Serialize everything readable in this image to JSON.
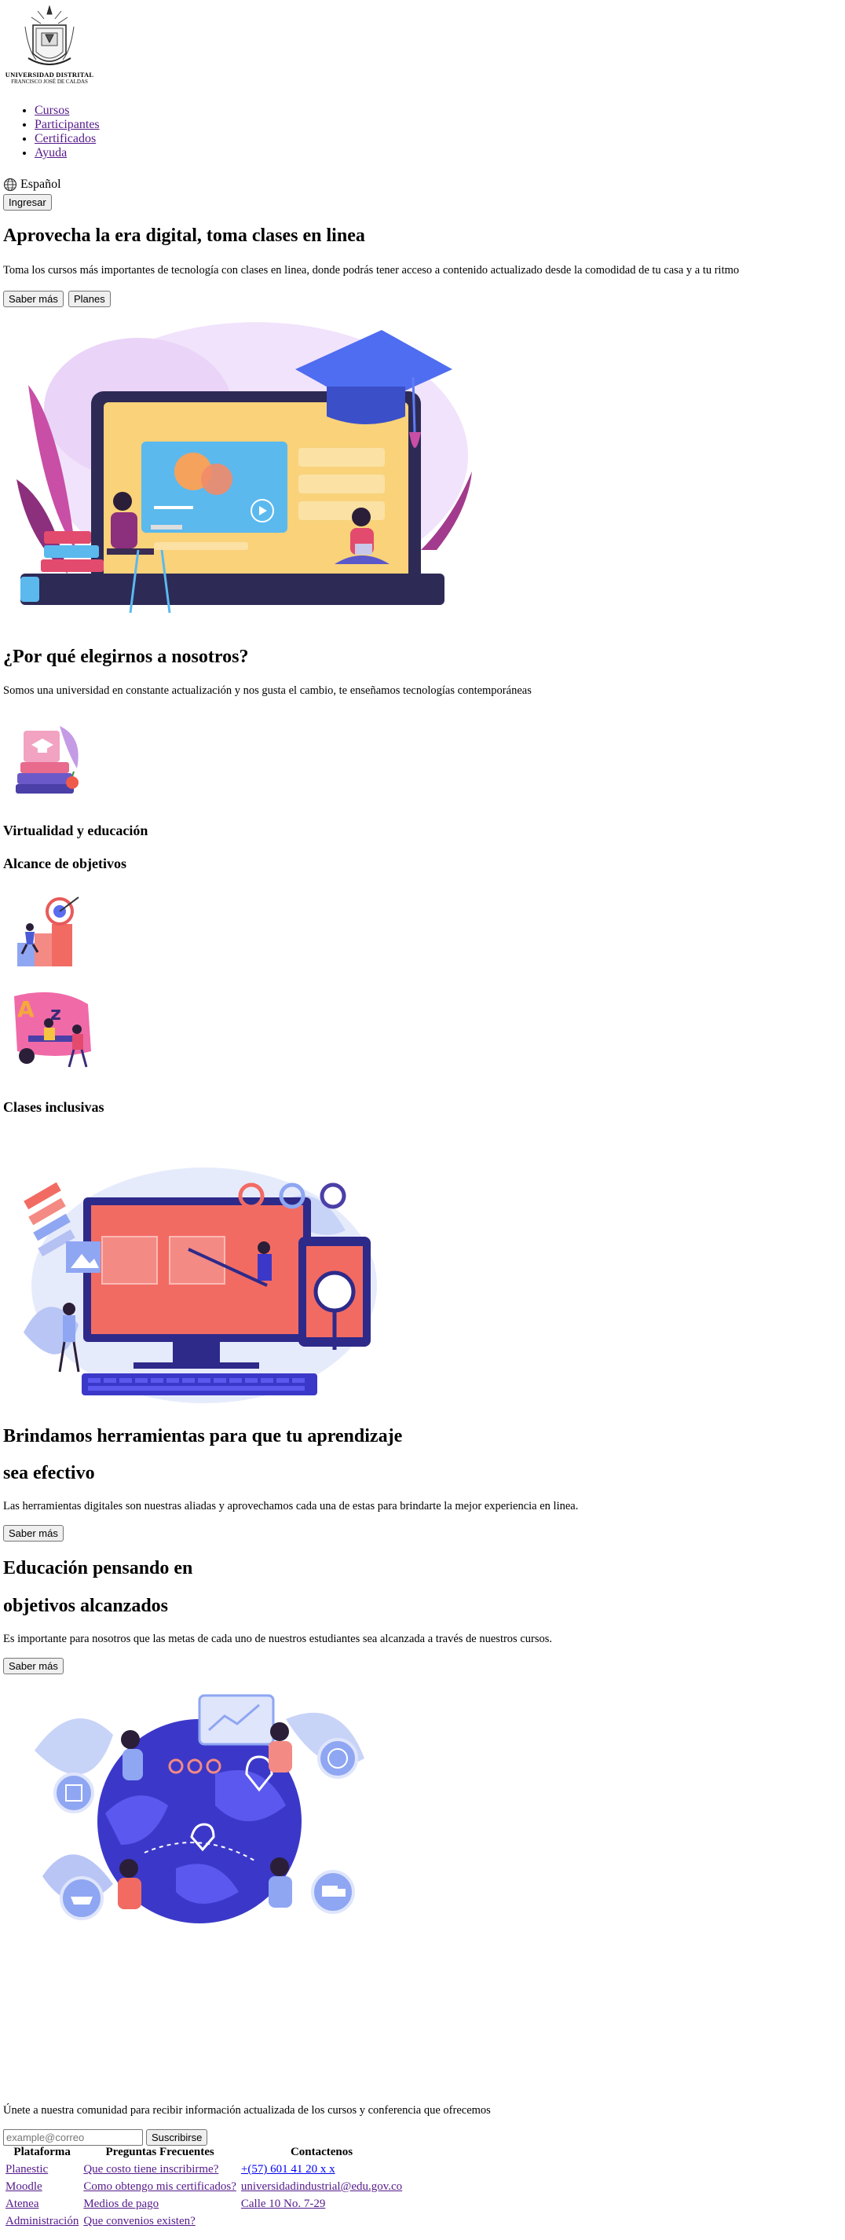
{
  "header": {
    "logo_line1": "UNIVERSIDAD DISTRITAL",
    "logo_line2": "FRANCISCO JOSÉ DE CALDAS",
    "nav": [
      "Cursos",
      "Participantes",
      "Certificados",
      "Ayuda"
    ],
    "language": "Español",
    "login_label": "Ingresar"
  },
  "hero": {
    "title": "Aprovecha la era digital, toma clases en linea",
    "text": "Toma los cursos más importantes de tecnología con clases en linea, donde podrás tener acceso a contenido actualizado desde la comodidad de tu casa y a tu ritmo",
    "btn_more": "Saber más",
    "btn_plans": "Planes"
  },
  "why": {
    "title": "¿Por qué elegirnos a nosotros?",
    "text": "Somos una universidad en constante actualización y nos gusta el cambio, te enseñamos tecnologías contemporáneas",
    "items": [
      "Virtualidad y educación",
      "Alcance de objetivos",
      "Clases inclusivas"
    ]
  },
  "tools": {
    "title_line1": "Brindamos herramientas para que tu aprendizaje",
    "title_line2": "sea efectivo",
    "text": "Las herramientas digitales son nuestras aliadas y aprovechamos cada una de estas para brindarte la mejor experiencia en linea.",
    "btn": "Saber más"
  },
  "goals": {
    "title_line1": "Educación pensando en",
    "title_line2": "objetivos alcanzados",
    "text": "Es importante para nosotros que las metas de cada uno de nuestros estudiantes sea alcanzada a través de nuestros cursos.",
    "btn": "Saber más"
  },
  "newsletter": {
    "text": "Únete a nuestra comunidad para recibir información actualizada de los cursos y conferencia que ofrecemos",
    "placeholder": "example@correo",
    "btn": "Suscribirse"
  },
  "footer": {
    "col1": {
      "title": "Plataforma",
      "links": [
        "Planestic",
        "Moodle",
        "Atenea",
        "Administración"
      ]
    },
    "col2": {
      "title": "Preguntas Frecuentes",
      "links": [
        "Que costo tiene inscribirme?",
        "Como obtengo mis certificados?",
        "Medios de pago",
        "Que convenios existen?"
      ]
    },
    "col3": {
      "title": "Contactenos",
      "links": [
        "+(57) 601 41 20 x x",
        "universidadindustrial@edu.gov.co",
        "Calle 10 No. 7-29"
      ]
    }
  }
}
